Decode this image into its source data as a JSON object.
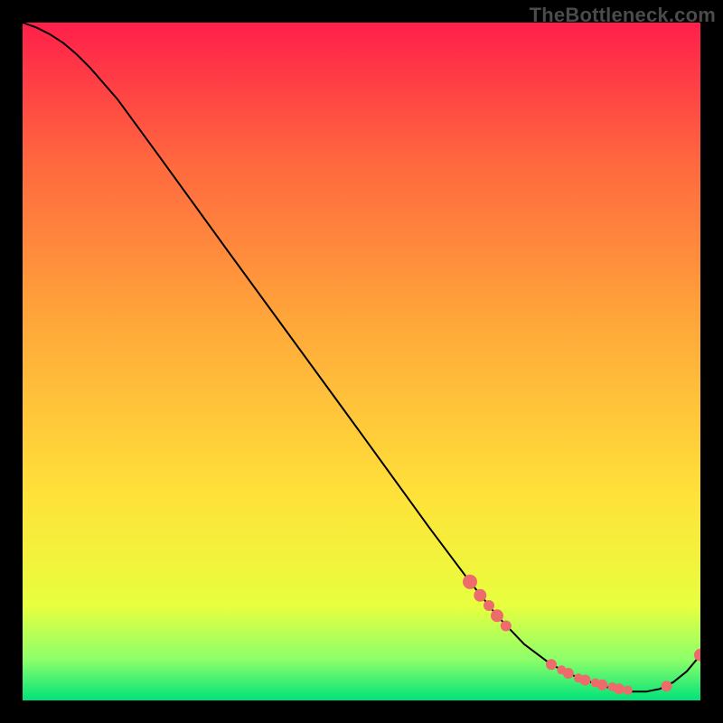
{
  "watermark": {
    "text": "TheBottleneck.com"
  },
  "chart_data": {
    "type": "line",
    "title": "",
    "xlabel": "",
    "ylabel": "",
    "xlim": [
      0,
      100
    ],
    "ylim": [
      0,
      100
    ],
    "grid": false,
    "legend": false,
    "background_gradient": {
      "top_color": "#ff1f4a",
      "band1_color": "#ff663f",
      "mid_color": "#ffa93a",
      "band3_color": "#ffe239",
      "band_green_top": "#e8ff3e",
      "band_green_mid": "#8cff6a",
      "bottom_color": "#00e27a"
    },
    "series": [
      {
        "name": "curve",
        "color": "#000000",
        "x": [
          0,
          2,
          4,
          6,
          8,
          10,
          14,
          20,
          30,
          40,
          50,
          60,
          66,
          70,
          74,
          78,
          82,
          86,
          90,
          92,
          94,
          96,
          98,
          100
        ],
        "y": [
          100,
          99.3,
          98.3,
          97,
          95.3,
          93.3,
          88.7,
          80.5,
          66.7,
          53,
          39.3,
          25.5,
          17.5,
          12.5,
          8.3,
          5.3,
          3.3,
          2,
          1.3,
          1.3,
          1.7,
          2.7,
          4.3,
          6.7
        ]
      }
    ],
    "markers": {
      "color": "#ed6b6b",
      "radius_scale": 1.0,
      "points": [
        {
          "x": 66,
          "y": 17.5,
          "r": 8
        },
        {
          "x": 67.5,
          "y": 15.5,
          "r": 7
        },
        {
          "x": 68.8,
          "y": 14,
          "r": 6
        },
        {
          "x": 70,
          "y": 12.5,
          "r": 7
        },
        {
          "x": 71.3,
          "y": 11,
          "r": 6
        },
        {
          "x": 78,
          "y": 5.3,
          "r": 6
        },
        {
          "x": 79.5,
          "y": 4.5,
          "r": 5
        },
        {
          "x": 80.5,
          "y": 4,
          "r": 6
        },
        {
          "x": 82,
          "y": 3.3,
          "r": 5
        },
        {
          "x": 83,
          "y": 3,
          "r": 6
        },
        {
          "x": 84.5,
          "y": 2.6,
          "r": 5
        },
        {
          "x": 85.5,
          "y": 2.3,
          "r": 6
        },
        {
          "x": 87,
          "y": 2,
          "r": 5
        },
        {
          "x": 88,
          "y": 1.7,
          "r": 6
        },
        {
          "x": 89.3,
          "y": 1.5,
          "r": 5
        },
        {
          "x": 95,
          "y": 2.1,
          "r": 6
        },
        {
          "x": 100,
          "y": 6.7,
          "r": 7
        }
      ]
    }
  }
}
